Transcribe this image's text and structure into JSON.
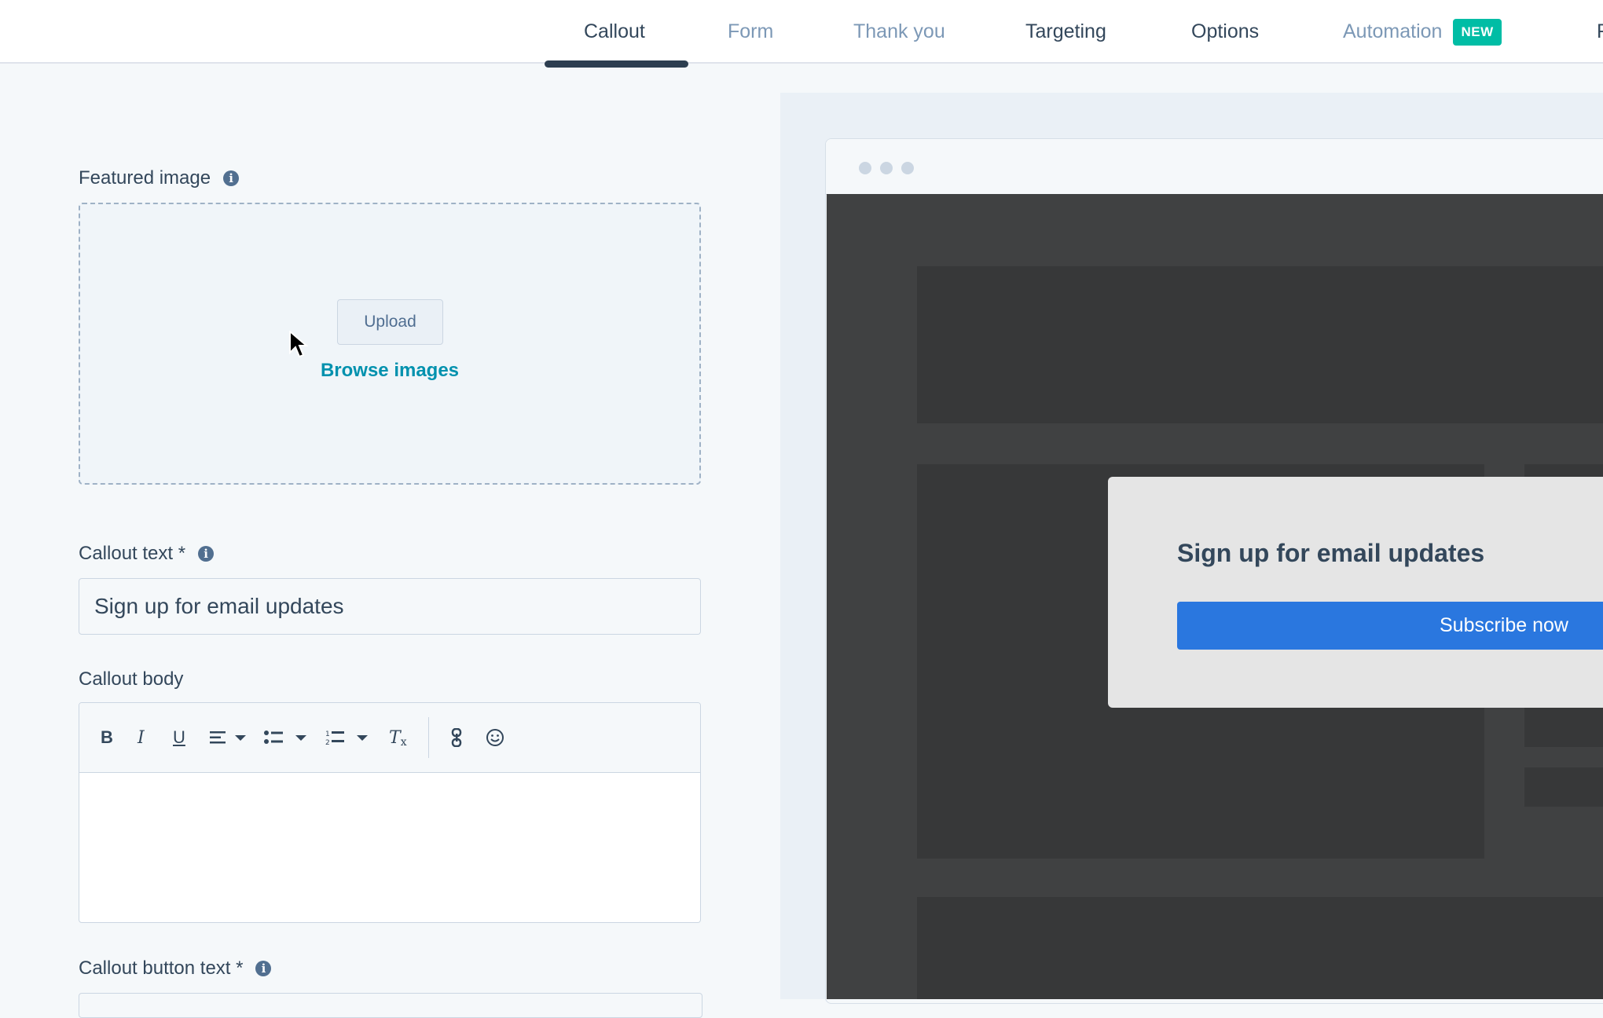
{
  "tabs": [
    {
      "label": "Callout",
      "active": true
    },
    {
      "label": "Form"
    },
    {
      "label": "Thank you"
    },
    {
      "label": "Targeting"
    },
    {
      "label": "Options"
    },
    {
      "label": "Automation",
      "badge": "NEW"
    },
    {
      "label": "F"
    }
  ],
  "form": {
    "featured_image": {
      "label": "Featured image",
      "upload_label": "Upload",
      "browse_label": "Browse images"
    },
    "callout_text": {
      "label": "Callout text *",
      "value": "Sign up for email updates"
    },
    "callout_body": {
      "label": "Callout body",
      "toolbar_icons": [
        "bold-icon",
        "italic-icon",
        "underline-icon",
        "align-icon",
        "bullet-list-icon",
        "numbered-list-icon",
        "clear-format-icon",
        "link-icon",
        "emoji-icon"
      ],
      "value": ""
    },
    "callout_button_text": {
      "label": "Callout button text *"
    }
  },
  "preview": {
    "popup_title": "Sign up for email updates",
    "popup_button": "Subscribe now"
  },
  "colors": {
    "accent_link": "#0091ae",
    "badge": "#00bda5",
    "popup_button": "#2a77df",
    "tab_underline": "#2d3e50"
  }
}
